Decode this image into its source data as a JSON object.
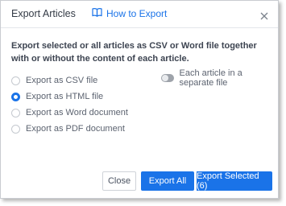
{
  "dialog": {
    "title": "Export Articles",
    "how_to_label": "How to Export",
    "description": "Export selected or all articles as CSV or Word file together with or without the content of each article."
  },
  "options": [
    {
      "label": "Export as CSV file",
      "selected": false
    },
    {
      "label": "Export as HTML file",
      "selected": true
    },
    {
      "label": "Export as Word document",
      "selected": false
    },
    {
      "label": "Export as PDF document",
      "selected": false
    }
  ],
  "toggle": {
    "label": "Each article in a separate file",
    "on": false
  },
  "buttons": {
    "close": "Close",
    "export_all": "Export All",
    "export_selected": "Export Selected (6)"
  },
  "colors": {
    "accent": "#1a73e8",
    "text": "#3d4451"
  }
}
